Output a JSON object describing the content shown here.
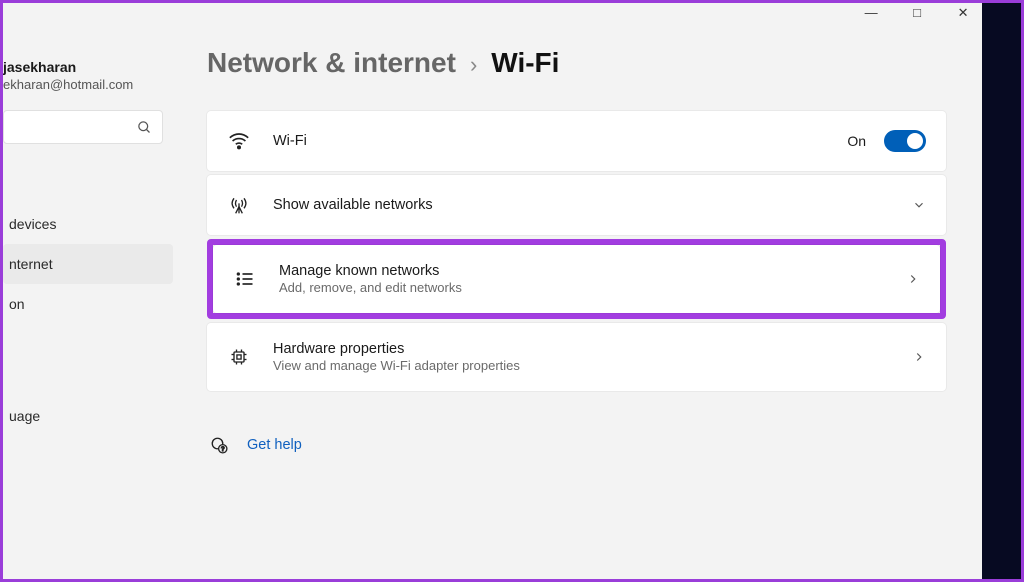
{
  "window": {
    "minimize": "—",
    "maximize": "□",
    "close": "✕"
  },
  "profile": {
    "name": "jasekharan",
    "email": "ekharan@hotmail.com"
  },
  "search": {
    "placeholder": ""
  },
  "sidebar": {
    "items": [
      {
        "label": "devices"
      },
      {
        "label": "nternet"
      },
      {
        "label": "on"
      },
      {
        "label": "uage"
      }
    ]
  },
  "breadcrumb": {
    "parent": "Network & internet",
    "separator": "›",
    "current": "Wi-Fi"
  },
  "cards": {
    "wifi": {
      "title": "Wi-Fi",
      "state": "On"
    },
    "available": {
      "title": "Show available networks"
    },
    "known": {
      "title": "Manage known networks",
      "sub": "Add, remove, and edit networks"
    },
    "hardware": {
      "title": "Hardware properties",
      "sub": "View and manage Wi-Fi adapter properties"
    }
  },
  "help": {
    "label": "Get help"
  }
}
